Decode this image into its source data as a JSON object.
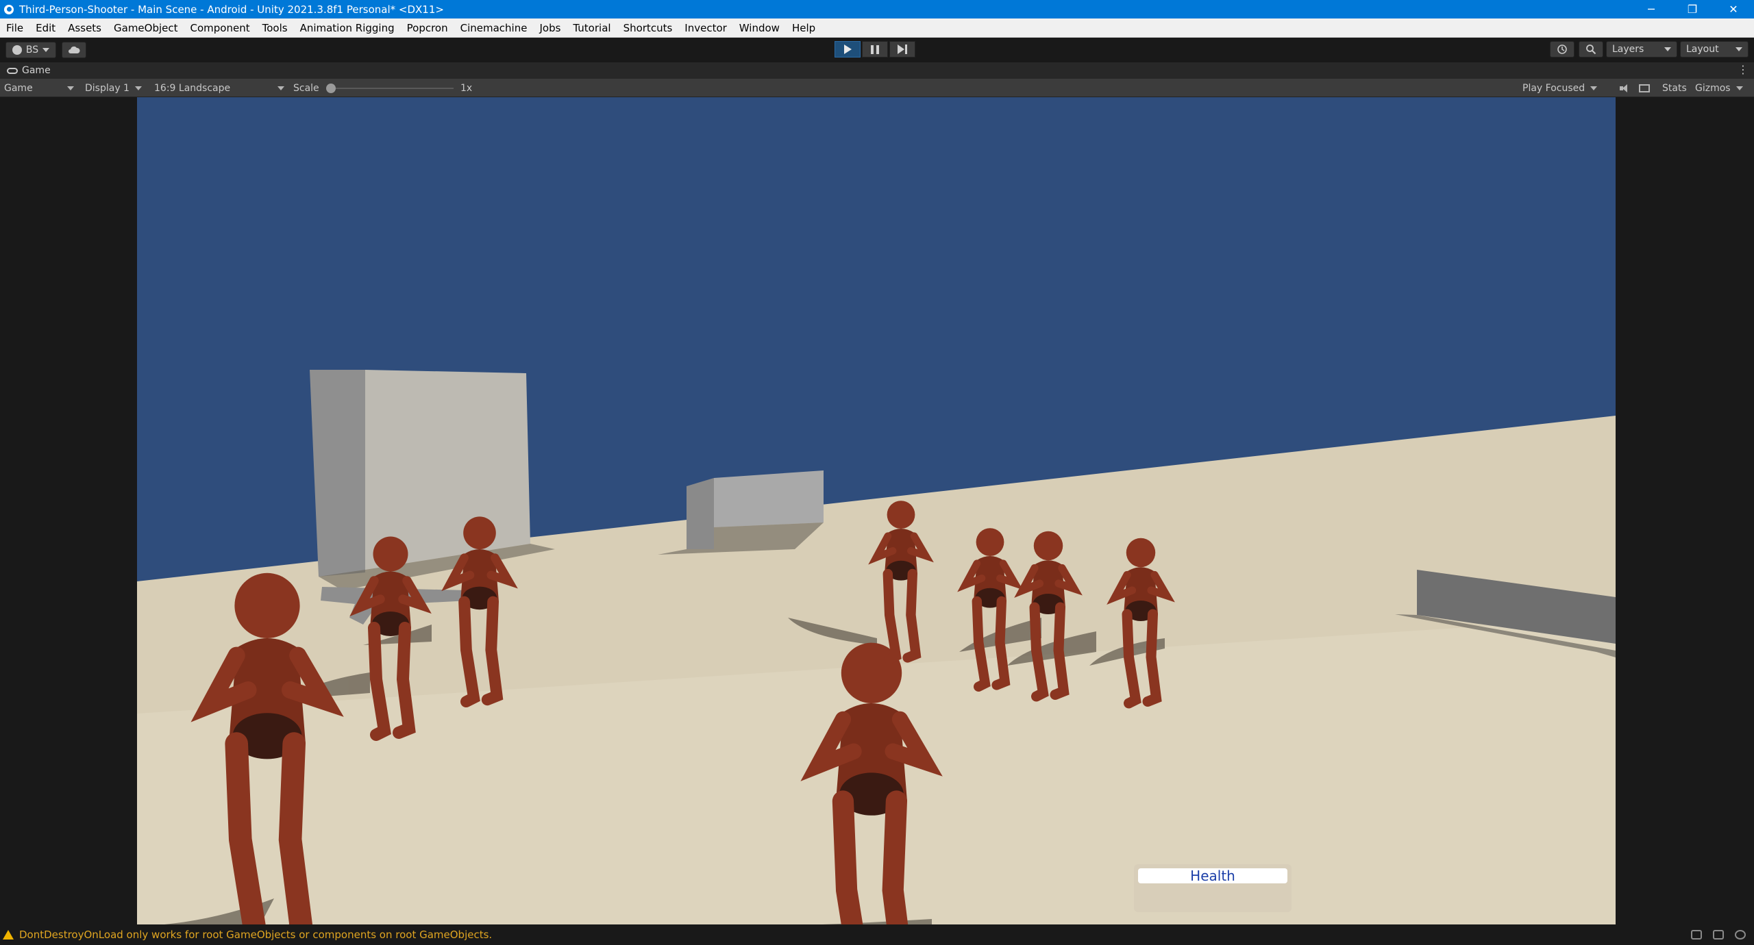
{
  "window": {
    "title": "Third-Person-Shooter - Main Scene - Android - Unity 2021.3.8f1 Personal* <DX11>",
    "minimize": "─",
    "restore": "❐",
    "close": "✕"
  },
  "menu": [
    "File",
    "Edit",
    "Assets",
    "GameObject",
    "Component",
    "Tools",
    "Animation Rigging",
    "Popcron",
    "Cinemachine",
    "Jobs",
    "Tutorial",
    "Shortcuts",
    "Invector",
    "Window",
    "Help"
  ],
  "toolbar": {
    "account_label": "BS",
    "layers_label": "Layers",
    "layout_label": "Layout",
    "play_state": "playing",
    "icons": [
      "account-icon",
      "cloud-icon",
      "play-icon",
      "pause-icon",
      "step-icon",
      "history-icon",
      "search-icon"
    ]
  },
  "game_tab": {
    "label": "Game",
    "view_mode": "Game",
    "display": "Display 1",
    "aspect": "16:9 Landscape",
    "scale_label": "Scale",
    "scale_value": "1x",
    "play_mode": "Play Focused",
    "stats_label": "Stats",
    "gizmos_label": "Gizmos"
  },
  "hud": {
    "health_label": "Health"
  },
  "status": {
    "message": "DontDestroyOnLoad only works for root GameObjects or components on root GameObjects."
  },
  "colors": {
    "sky": "#2f4d7c",
    "ground": "#d8ceb6",
    "character": "#8a3520",
    "titlebar": "#0078d7",
    "warning": "#e0a521"
  }
}
